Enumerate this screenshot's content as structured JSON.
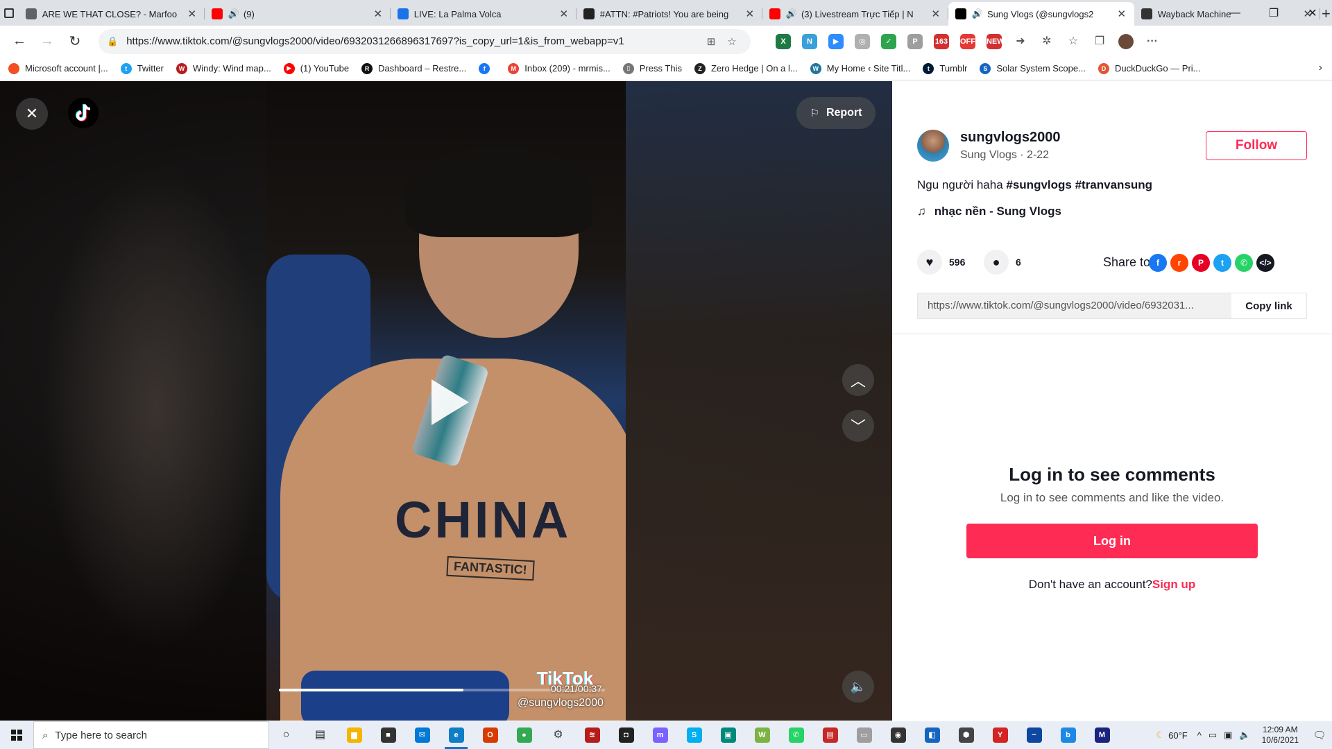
{
  "browser": {
    "tabs": [
      {
        "title": "ARE WE THAT CLOSE? - Marfoo",
        "favicon_color": "#5f6368",
        "audio": false
      },
      {
        "title": "(9)",
        "favicon_color": "#ff0000",
        "audio": true
      },
      {
        "title": "LIVE: La Palma Volca",
        "favicon_color": "#1a73e8",
        "audio": false
      },
      {
        "title": "#ATTN: #Patriots! You are being",
        "favicon_color": "#222222",
        "audio": false
      },
      {
        "title": "(3) Livestream Trực Tiếp | N",
        "favicon_color": "#ff0000",
        "audio": true
      },
      {
        "title": "Sung Vlogs (@sungvlogs2",
        "favicon_color": "#000000",
        "audio": true
      },
      {
        "title": "Wayback Machine",
        "favicon_color": "#333333",
        "audio": false
      }
    ],
    "active_tab_index": 5,
    "url": "https://www.tiktok.com/@sungvlogs2000/video/6932031266896317697?is_copy_url=1&is_from_webapp=v1",
    "extensions": [
      {
        "name": "excel-icon",
        "color": "#1d7a43",
        "glyph": "X"
      },
      {
        "name": "n-icon",
        "color": "#3aa0d8",
        "glyph": "N"
      },
      {
        "name": "zoom-icon",
        "color": "#2d8cff",
        "glyph": "▶"
      },
      {
        "name": "sync-icon",
        "color": "#b0b0b0",
        "glyph": "◎"
      },
      {
        "name": "check-icon",
        "color": "#2ea44f",
        "glyph": "✓"
      },
      {
        "name": "pinterest-icon",
        "color": "#9e9e9e",
        "glyph": "P"
      },
      {
        "name": "163-icon",
        "color": "#d32f2f",
        "glyph": "163"
      },
      {
        "name": "off-icon",
        "color": "#e53935",
        "glyph": "OFF"
      },
      {
        "name": "new-icon",
        "color": "#d32f2f",
        "glyph": "NEW"
      },
      {
        "name": "arrow-icon",
        "color": "#555555",
        "glyph": "➜"
      },
      {
        "name": "puzzle-icon",
        "color": "#555555",
        "glyph": "✲"
      },
      {
        "name": "favorites-icon",
        "color": "#555555",
        "glyph": "☆"
      },
      {
        "name": "collections-icon",
        "color": "#555555",
        "glyph": "❐"
      },
      {
        "name": "profile-avatar-icon",
        "color": "#6b4a3a",
        "glyph": ""
      },
      {
        "name": "more-icon",
        "color": "#555555",
        "glyph": "···"
      }
    ],
    "bookmarks": [
      {
        "label": "Microsoft account |...",
        "color": "#f25022",
        "glyph": ""
      },
      {
        "label": "Twitter",
        "color": "#1da1f2",
        "glyph": "t"
      },
      {
        "label": "Windy: Wind map...",
        "color": "#b71c1c",
        "glyph": "W"
      },
      {
        "label": "(1) YouTube",
        "color": "#ff0000",
        "glyph": "▶"
      },
      {
        "label": "Dashboard – Restre...",
        "color": "#111111",
        "glyph": "R"
      },
      {
        "label": "",
        "color": "#1877f2",
        "glyph": "f"
      },
      {
        "label": "Inbox (209) - mrmis...",
        "color": "#ea4335",
        "glyph": "M"
      },
      {
        "label": "Press This",
        "color": "#777777",
        "glyph": "▯"
      },
      {
        "label": "Zero Hedge | On a l...",
        "color": "#222222",
        "glyph": "Z"
      },
      {
        "label": "My Home ‹ Site Titl...",
        "color": "#21759b",
        "glyph": "W"
      },
      {
        "label": "Tumblr",
        "color": "#001935",
        "glyph": "t"
      },
      {
        "label": "Solar System Scope...",
        "color": "#1565c0",
        "glyph": "S"
      },
      {
        "label": "DuckDuckGo — Pri...",
        "color": "#de5833",
        "glyph": "D"
      }
    ]
  },
  "video": {
    "shirt_text": "CHINA",
    "shirt_subtext": "FANTASTIC!",
    "time": "00:21/00:37",
    "progress": 0.567,
    "watermark": "TikTok",
    "watermark_user": "@sungvlogs2000",
    "report_label": "Report"
  },
  "post": {
    "username": "sungvlogs2000",
    "display_meta": "Sung Vlogs · 2-22",
    "follow_label": "Follow",
    "caption_text": "Ngu người haha ",
    "hashtags": "#sungvlogs #tranvansung",
    "music": "nhạc nền - Sung Vlogs",
    "likes": "596",
    "comments": "6",
    "share_label": "Share to",
    "share_targets": [
      {
        "name": "facebook-share-icon",
        "color": "#1877f2",
        "glyph": "f"
      },
      {
        "name": "reddit-share-icon",
        "color": "#ff4500",
        "glyph": "r"
      },
      {
        "name": "pinterest-share-icon",
        "color": "#e60023",
        "glyph": "P"
      },
      {
        "name": "twitter-share-icon",
        "color": "#1da1f2",
        "glyph": "t"
      },
      {
        "name": "whatsapp-share-icon",
        "color": "#25d366",
        "glyph": "✆"
      },
      {
        "name": "embed-share-icon",
        "color": "#161823",
        "glyph": "</>"
      }
    ],
    "copy_url": "https://www.tiktok.com/@sungvlogs2000/video/6932031...",
    "copy_link_label": "Copy link"
  },
  "login": {
    "title": "Log in to see comments",
    "subtitle": "Log in to see comments and like the video.",
    "button": "Log in",
    "no_account": "Don't have an account?",
    "signup": "Sign up"
  },
  "taskbar": {
    "search_placeholder": "Type here to search",
    "apps": [
      {
        "name": "cortana-icon",
        "color": "#222222",
        "glyph": "○"
      },
      {
        "name": "task-view-icon",
        "color": "#222222",
        "glyph": "▤"
      },
      {
        "name": "file-explorer-icon",
        "color": "#f4b400",
        "glyph": "▆"
      },
      {
        "name": "store-icon",
        "color": "#333333",
        "glyph": "■"
      },
      {
        "name": "mail-icon",
        "color": "#0078d4",
        "glyph": "✉"
      },
      {
        "name": "edge-icon",
        "color": "#0f7ec6",
        "glyph": "e"
      },
      {
        "name": "office-icon",
        "color": "#d83b01",
        "glyph": "O"
      },
      {
        "name": "chrome-icon",
        "color": "#34a853",
        "glyph": "●"
      },
      {
        "name": "settings-icon",
        "color": "#444444",
        "glyph": "⚙"
      },
      {
        "name": "app-red-icon",
        "color": "#b71c1c",
        "glyph": "≋"
      },
      {
        "name": "app-dark-icon",
        "color": "#222222",
        "glyph": "◘"
      },
      {
        "name": "messenger-icon",
        "color": "#7b61ff",
        "glyph": "m"
      },
      {
        "name": "skype-icon",
        "color": "#00aff0",
        "glyph": "S"
      },
      {
        "name": "app-teal-icon",
        "color": "#00897b",
        "glyph": "▣"
      },
      {
        "name": "app-green-icon",
        "color": "#7cb342",
        "glyph": "W"
      },
      {
        "name": "whatsapp-icon",
        "color": "#25d366",
        "glyph": "✆"
      },
      {
        "name": "app-system-icon",
        "color": "#c62828",
        "glyph": "▤"
      },
      {
        "name": "app-window-icon",
        "color": "#9e9e9e",
        "glyph": "▭"
      },
      {
        "name": "camera-icon",
        "color": "#333333",
        "glyph": "◉"
      },
      {
        "name": "app-blue-icon",
        "color": "#1565c0",
        "glyph": "◧"
      },
      {
        "name": "app-cube-icon",
        "color": "#444444",
        "glyph": "⬢"
      },
      {
        "name": "yelp-icon",
        "color": "#d32323",
        "glyph": "Y"
      },
      {
        "name": "app-wave-icon",
        "color": "#0d47a1",
        "glyph": "~"
      },
      {
        "name": "app-b-icon",
        "color": "#1e88e5",
        "glyph": "b"
      },
      {
        "name": "app-m-icon",
        "color": "#1a237e",
        "glyph": "M"
      }
    ],
    "temperature": "60°F",
    "time": "12:09 AM",
    "date": "10/6/2021"
  }
}
